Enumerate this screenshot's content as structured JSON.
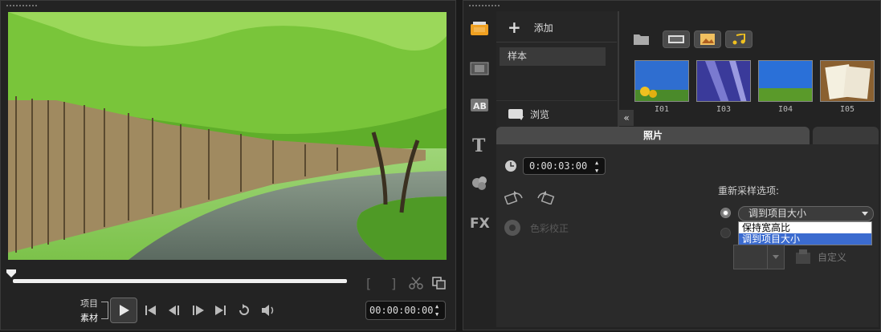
{
  "player": {
    "mode_project": "项目",
    "mode_clip": "素材",
    "timecode": "00:00:00:00"
  },
  "library": {
    "add_label": "添加",
    "folder_item": "样本",
    "browse_label": "浏览",
    "thumbnails": [
      {
        "label": "I01"
      },
      {
        "label": "I03"
      },
      {
        "label": "I04"
      },
      {
        "label": "I05"
      }
    ]
  },
  "options": {
    "tab_photo": "照片",
    "duration": "0:00:03:00",
    "color_correction": "色彩校正",
    "resample_label": "重新采样选项:",
    "resample_selected": "调到项目大小",
    "resample_options": [
      "保持宽高比",
      "调到项目大小"
    ],
    "custom_label": "自定义"
  },
  "colors": {
    "selection": "#3b6bcf",
    "foliage": "#5fae2a",
    "panel": "#232323"
  },
  "icons": [
    "play-icon",
    "home-icon",
    "prev-frame-icon",
    "next-frame-icon",
    "end-icon",
    "repeat-icon",
    "volume-icon",
    "scissors-icon",
    "copy-icon",
    "folder-icon",
    "media-icon",
    "transition-icon",
    "title-icon",
    "graphics-icon",
    "fx-icon",
    "clock-icon",
    "rotate-left-icon",
    "rotate-right-icon"
  ]
}
